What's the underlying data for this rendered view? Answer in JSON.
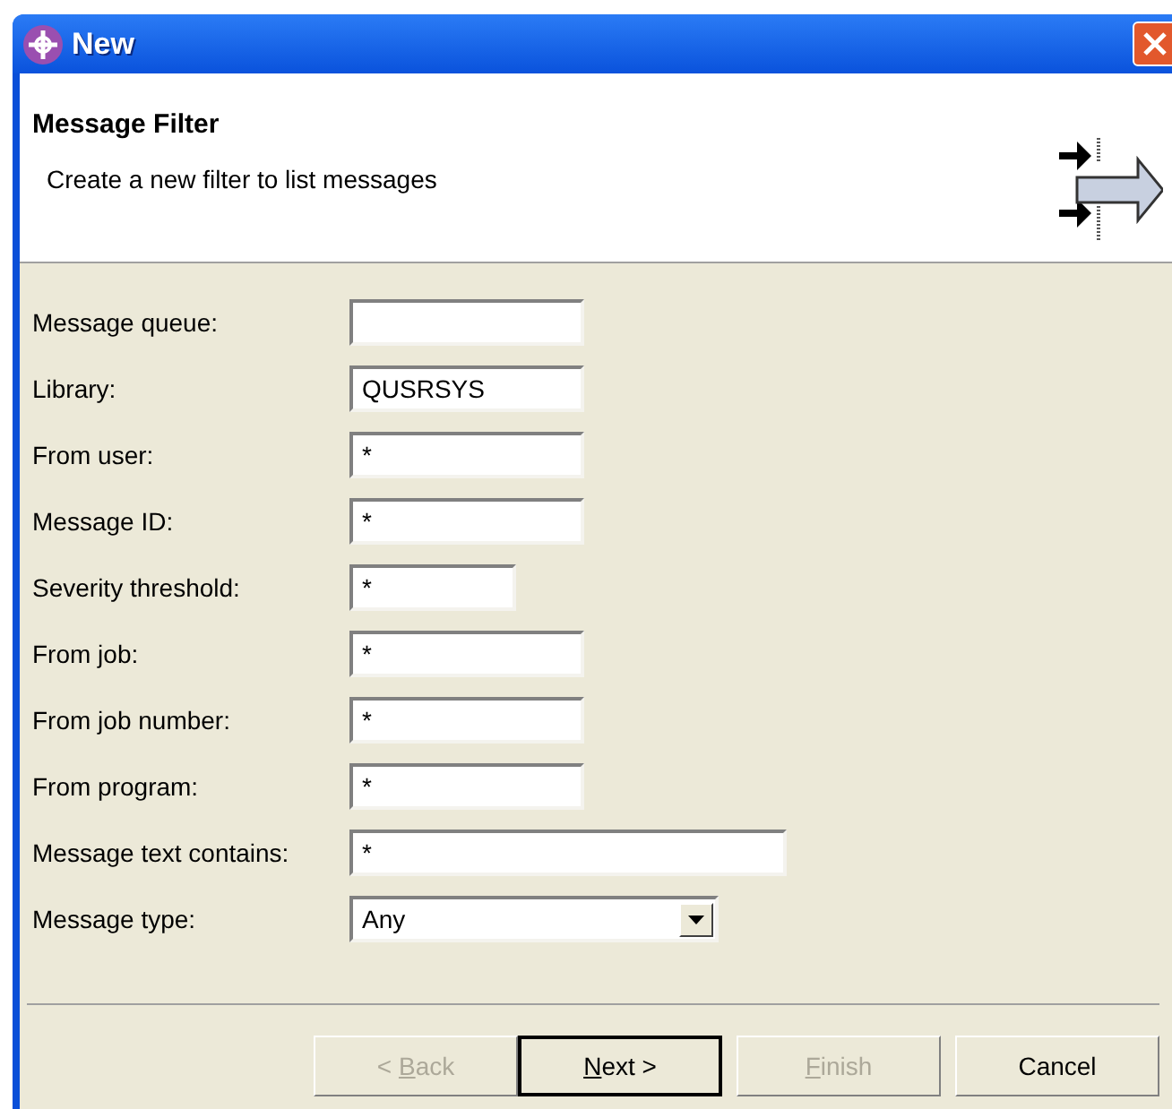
{
  "window": {
    "title": "New"
  },
  "header": {
    "title": "Message Filter",
    "description": "Create a new filter to list messages"
  },
  "fields": [
    {
      "label": "Message queue:",
      "kind": "text"
    },
    {
      "label": "Library:",
      "kind": "text",
      "value": "QUSRSYS"
    },
    {
      "label": "From user:",
      "kind": "text",
      "value": "*"
    },
    {
      "label": "Message ID:",
      "kind": "text",
      "value": "*"
    },
    {
      "label": "Severity threshold:",
      "kind": "text",
      "value": "*"
    },
    {
      "label": "From job:",
      "kind": "text",
      "value": "*"
    },
    {
      "label": "From job number:",
      "kind": "text",
      "value": "*"
    },
    {
      "label": "From program:",
      "kind": "text",
      "value": "*"
    },
    {
      "label": "Message text contains:",
      "kind": "text",
      "value": "*"
    },
    {
      "label": "Message type:",
      "kind": "combo",
      "value": "Any"
    }
  ],
  "buttons": [
    {
      "before": "< ",
      "mnemonic": "B",
      "after": "ack",
      "disabled": true,
      "default": false
    },
    {
      "mnemonic": "N",
      "after": "ext >",
      "disabled": false,
      "default": true
    },
    {
      "mnemonic": "F",
      "after": "inish",
      "disabled": true,
      "default": false
    },
    {
      "before": "Cancel",
      "disabled": false,
      "default": false
    }
  ]
}
